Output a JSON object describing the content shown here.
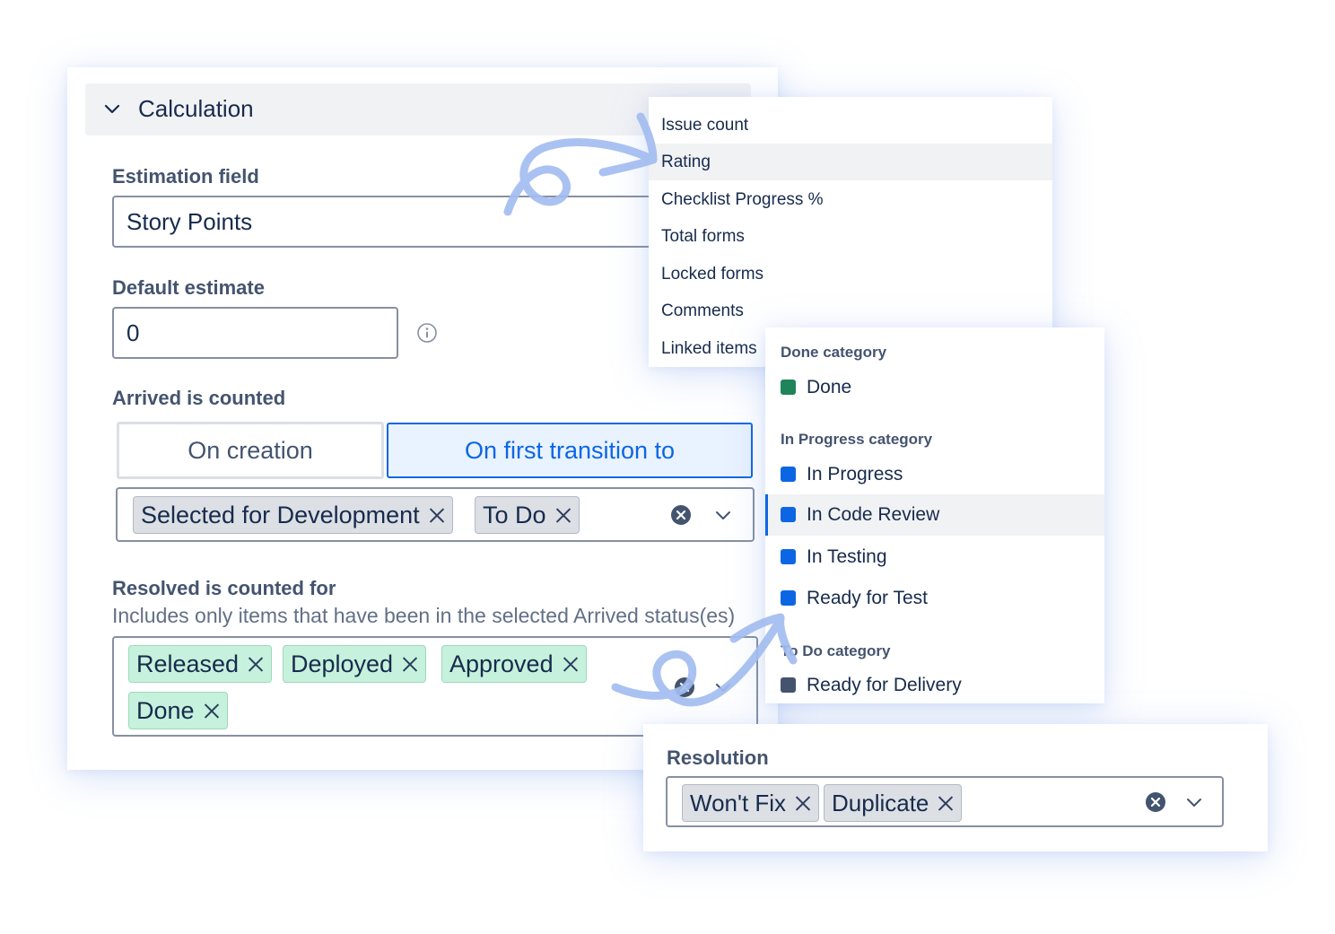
{
  "calculation": {
    "title": "Calculation",
    "estimation_label": "Estimation field",
    "estimation_value": "Story Points",
    "default_label": "Default estimate",
    "default_value": "0",
    "arrived_label": "Arrived is counted",
    "toggle_creation": "On creation",
    "toggle_transition": "On first transition to",
    "arrived_chips": [
      "Selected for Development",
      "To Do"
    ],
    "resolved_label": "Resolved is counted for",
    "resolved_desc": "Includes only items that have been in the selected Arrived status(es)",
    "resolved_chips": [
      "Released",
      "Deployed",
      "Approved",
      "Done"
    ]
  },
  "field_dropdown": {
    "items": [
      "Issue count",
      "Rating",
      "Checklist Progress %",
      "Total forms",
      "Locked forms",
      "Comments",
      "Linked items"
    ],
    "highlighted": "Rating"
  },
  "status_dropdown": {
    "groups": [
      {
        "label": "Done category",
        "statuses": [
          {
            "name": "Done",
            "color": "#1f845a"
          }
        ]
      },
      {
        "label": "In Progress category",
        "statuses": [
          {
            "name": "In Progress",
            "color": "#0c66e4"
          },
          {
            "name": "In Code Review",
            "color": "#0c66e4"
          },
          {
            "name": "In Testing",
            "color": "#0c66e4"
          },
          {
            "name": "Ready for Test",
            "color": "#0c66e4"
          }
        ]
      },
      {
        "label": "To Do category",
        "statuses": [
          {
            "name": "Ready for Delivery",
            "color": "#44546f"
          }
        ]
      }
    ],
    "highlighted": "In Code Review"
  },
  "resolution": {
    "label": "Resolution",
    "chips": [
      "Won't Fix",
      "Duplicate"
    ]
  },
  "colors": {
    "accent": "#0c66e4",
    "accent_bg": "#e9f2ff",
    "chip_green": "#c6f1dc",
    "chip_grey": "#dcdfe4",
    "arrow": "#a3bdf0"
  }
}
